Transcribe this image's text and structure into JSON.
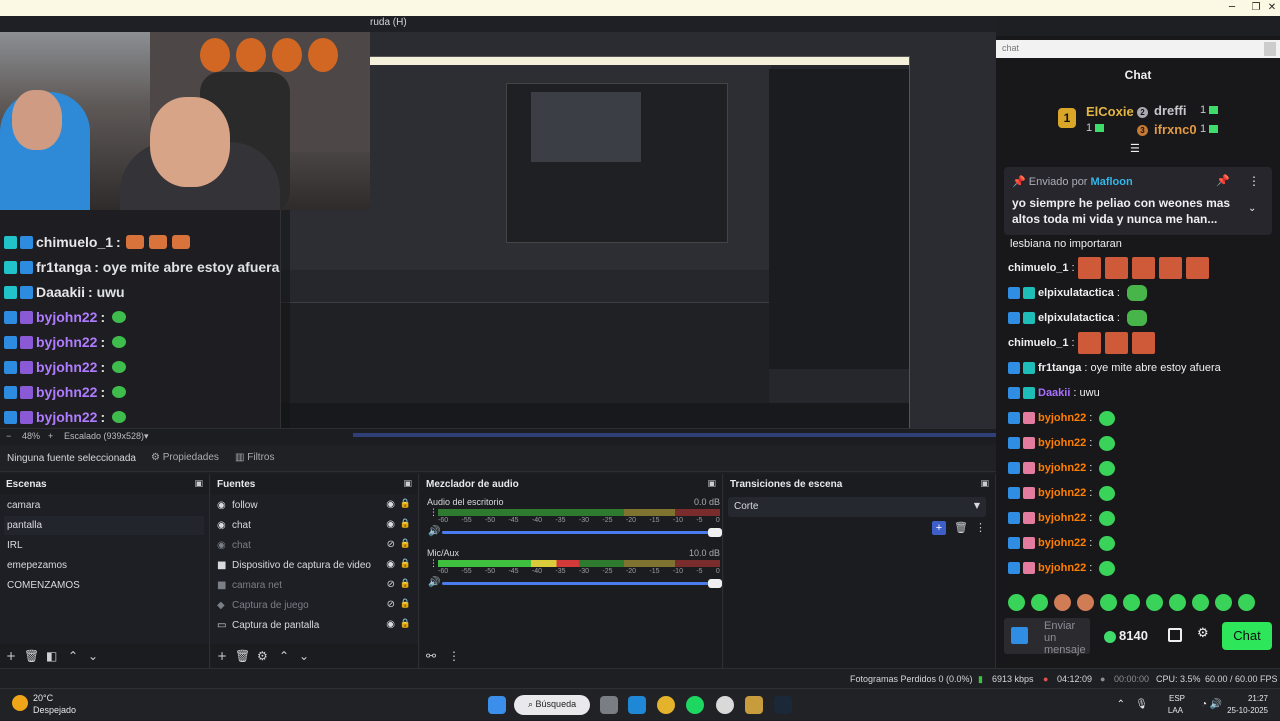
{
  "window": {
    "menu_help": "ruda (H)",
    "minimize": "─",
    "maximize": "❐",
    "close": "✕"
  },
  "preview": {
    "big_chat": [
      {
        "user": "chimuelo_1",
        "msg": ":",
        "type": "faces"
      },
      {
        "user": "fr1tanga",
        "msg": ": oye mite abre estoy afuera",
        "type": "text"
      },
      {
        "user": "Daaakii",
        "msg": ": uwu",
        "type": "text"
      },
      {
        "user": "byjohn22",
        "msg": ":",
        "type": "emote"
      },
      {
        "user": "byjohn22",
        "msg": ":",
        "type": "emote"
      },
      {
        "user": "byjohn22",
        "msg": ":",
        "type": "emote"
      },
      {
        "user": "byjohn22",
        "msg": ":",
        "type": "emote"
      },
      {
        "user": "byjohn22",
        "msg": ":",
        "type": "emote"
      }
    ],
    "zoom": "48%",
    "scale": "Escalado (939x528)"
  },
  "source_bar": {
    "no_source": "Ninguna fuente seleccionada",
    "properties": "Propiedades",
    "filters": "Filtros"
  },
  "scenes": {
    "title": "Escenas",
    "items": [
      "camara",
      "pantalla",
      "IRL",
      "emepezamos",
      "COMENZAMOS"
    ],
    "active": "pantalla"
  },
  "sources": {
    "title": "Fuentes",
    "items": [
      {
        "label": "follow",
        "icon": "globe-icon",
        "glyph": "◉",
        "visible": true
      },
      {
        "label": "chat",
        "icon": "globe-icon",
        "glyph": "◉",
        "visible": true
      },
      {
        "label": "chat",
        "icon": "globe-icon",
        "glyph": "◉",
        "visible": false
      },
      {
        "label": "Dispositivo de captura de video",
        "icon": "camera-icon",
        "glyph": "■",
        "visible": true
      },
      {
        "label": "camara net",
        "icon": "camera-icon",
        "glyph": "■",
        "visible": false
      },
      {
        "label": "Captura de juego",
        "icon": "gamepad-icon",
        "glyph": "◆",
        "visible": false
      },
      {
        "label": "Captura de pantalla",
        "icon": "monitor-icon",
        "glyph": "▭",
        "visible": true
      }
    ]
  },
  "mixer": {
    "title": "Mezclador de audio",
    "channels": [
      {
        "name": "Audio del escritorio",
        "db": "0.0 dB",
        "level": 0.0
      },
      {
        "name": "Mic/Aux",
        "db": "10.0 dB",
        "level": 0.5
      }
    ],
    "scale": [
      "-60",
      "-55",
      "-50",
      "-45",
      "-40",
      "-35",
      "-30",
      "-25",
      "-20",
      "-15",
      "-10",
      "-5",
      "0"
    ]
  },
  "transitions": {
    "title": "Transiciones de escena",
    "selected": "Corte"
  },
  "status": {
    "dropped": "Fotogramas Perdidos 0 (0.0%)",
    "bitrate": "6913 kbps",
    "stream_time": "04:12:09",
    "rec_time": "00:00:00",
    "cpu": "CPU: 3.5%",
    "fps": "60.00 / 60.00 FPS"
  },
  "chat": {
    "search_placeholder": "chat",
    "title": "Chat",
    "leaderboard": [
      {
        "rank": "1",
        "name": "ElCoxie",
        "count": "1"
      },
      {
        "rank": "2",
        "name": "dreffi",
        "count": "1"
      },
      {
        "rank": "3",
        "name": "ifrxnc0",
        "count": "1"
      }
    ],
    "pinned": {
      "by_prefix": "Enviado por",
      "by_user": "Mafloon",
      "text": "yo siempre he peliao con weones mas altos toda mi vida y nunca me han..."
    },
    "partial_line": "lesbiana no importaran",
    "messages": [
      {
        "user": "chimuelo_1",
        "msg": ":",
        "kind": "faces5",
        "color": "#efeff1"
      },
      {
        "user": "elpixulatactica",
        "msg": ":",
        "kind": "pepe",
        "color": "#efeff1"
      },
      {
        "user": "elpixulatactica",
        "msg": ":",
        "kind": "pepe",
        "color": "#efeff1"
      },
      {
        "user": "chimuelo_1",
        "msg": ":",
        "kind": "faces3",
        "color": "#efeff1"
      },
      {
        "user": "fr1tanga",
        "msg": ": oye mite abre estoy afuera",
        "kind": "text",
        "color": "#efeff1"
      },
      {
        "user": "Daakii",
        "msg": ": uwu",
        "kind": "text",
        "color": "#a970ff"
      },
      {
        "user": "byjohn22",
        "msg": ":",
        "kind": "blob",
        "color": "#ff7f00"
      },
      {
        "user": "byjohn22",
        "msg": ":",
        "kind": "blob",
        "color": "#ff7f00"
      },
      {
        "user": "byjohn22",
        "msg": ":",
        "kind": "blob",
        "color": "#ff7f00"
      },
      {
        "user": "byjohn22",
        "msg": ":",
        "kind": "blob",
        "color": "#ff7f00"
      },
      {
        "user": "byjohn22",
        "msg": ":",
        "kind": "blob",
        "color": "#ff7f00"
      },
      {
        "user": "byjohn22",
        "msg": ":",
        "kind": "blob",
        "color": "#ff7f00"
      },
      {
        "user": "byjohn22",
        "msg": ":",
        "kind": "blob",
        "color": "#ff7f00"
      }
    ],
    "input_placeholder": "Enviar un mensaje",
    "points": "8140",
    "send_label": "Chat"
  },
  "taskbar": {
    "temp": "20°C",
    "weather": "Despejado",
    "search": "Búsqueda",
    "lang1": "ESP",
    "lang2": "LAA",
    "time": "21:27",
    "date": "25-10-2025"
  },
  "colors": {
    "accent_green": "#2ee65a",
    "leader_gold": "#e3b543",
    "pinned_user": "#34b7e8"
  }
}
